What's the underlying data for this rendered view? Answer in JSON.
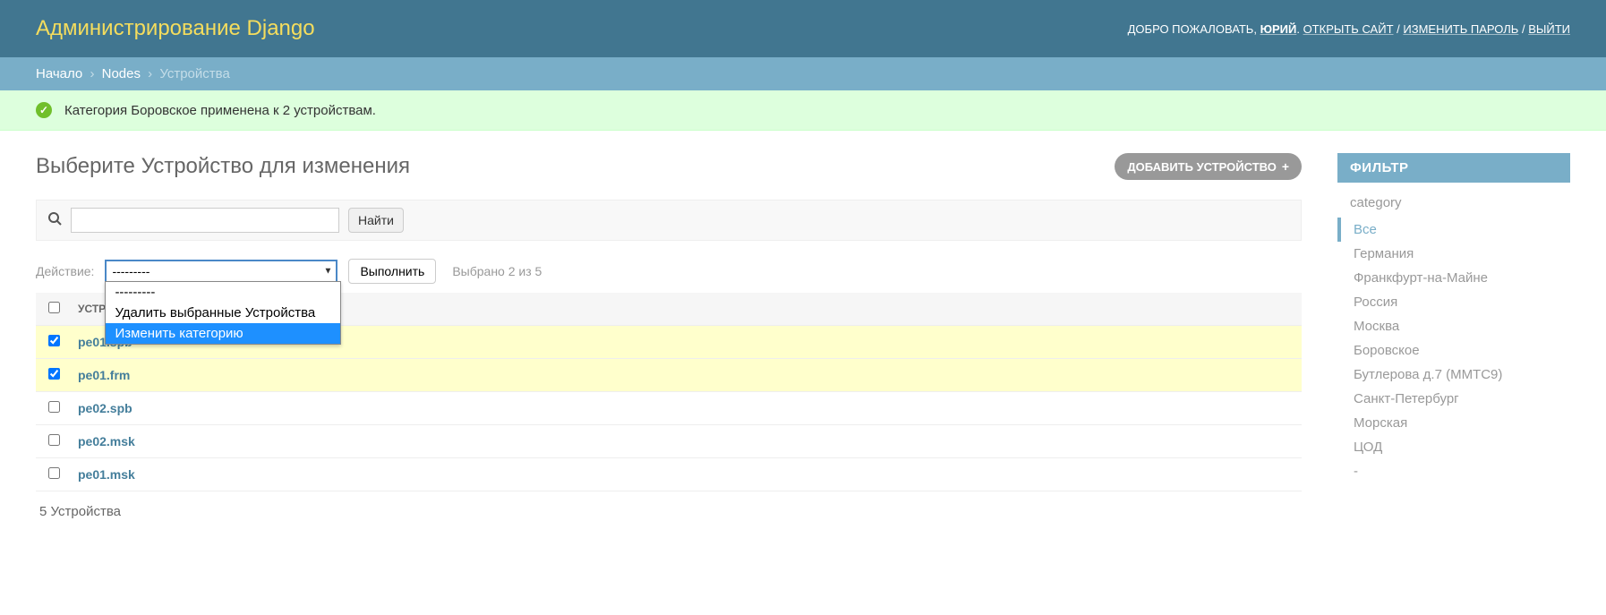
{
  "header": {
    "site_title": "Администрирование Django",
    "welcome": "ДОБРО ПОЖАЛОВАТЬ,",
    "username": "ЮРИЙ",
    "view_site": "ОТКРЫТЬ САЙТ",
    "change_password": "ИЗМЕНИТЬ ПАРОЛЬ",
    "logout": "ВЫЙТИ"
  },
  "breadcrumbs": {
    "home": "Начало",
    "app": "Nodes",
    "model": "Устройства"
  },
  "message": "Категория Боровское применена к 2 устройствам.",
  "page": {
    "title": "Выберите Устройство для изменения",
    "add_label": "ДОБАВИТЬ УСТРОЙСТВО"
  },
  "search": {
    "button": "Найти"
  },
  "actions": {
    "label": "Действие:",
    "selected_display": "---------",
    "go": "Выполнить",
    "selection_counter": "Выбрано 2 из 5",
    "options": {
      "blank": "---------",
      "delete": "Удалить выбранные Устройства",
      "change_category": "Изменить категорию"
    }
  },
  "table": {
    "header_col": "УСТРОЙСТВО",
    "rows": [
      {
        "name": "pe01.spb",
        "selected": true
      },
      {
        "name": "pe01.frm",
        "selected": true
      },
      {
        "name": "pe02.spb",
        "selected": false
      },
      {
        "name": "pe02.msk",
        "selected": false
      },
      {
        "name": "pe01.msk",
        "selected": false
      }
    ],
    "count_text": "5 Устройства"
  },
  "filter": {
    "header": "ФИЛЬТР",
    "group": "category",
    "items": [
      {
        "label": "Все",
        "active": true
      },
      {
        "label": "Германия",
        "active": false
      },
      {
        "label": "Франкфурт-на-Майне",
        "active": false
      },
      {
        "label": "Россия",
        "active": false
      },
      {
        "label": "Москва",
        "active": false
      },
      {
        "label": "Боровское",
        "active": false
      },
      {
        "label": "Бутлерова д.7 (ММТС9)",
        "active": false
      },
      {
        "label": "Санкт-Петербург",
        "active": false
      },
      {
        "label": "Морская",
        "active": false
      },
      {
        "label": "ЦОД",
        "active": false
      },
      {
        "label": "-",
        "active": false
      }
    ]
  }
}
